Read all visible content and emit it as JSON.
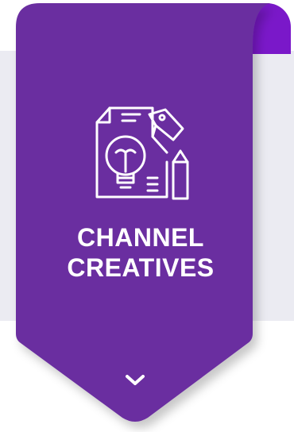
{
  "banner": {
    "title_line1": "CHANNEL",
    "title_line2": "CREATIVES",
    "icon": "idea-document-tag-pencil-icon",
    "expand_icon": "chevron-down-icon"
  },
  "colors": {
    "banner_purple": "#6b2fa0",
    "fold_purple": "#7a18c9",
    "card_background": "#ebebf2",
    "text": "#ffffff"
  }
}
